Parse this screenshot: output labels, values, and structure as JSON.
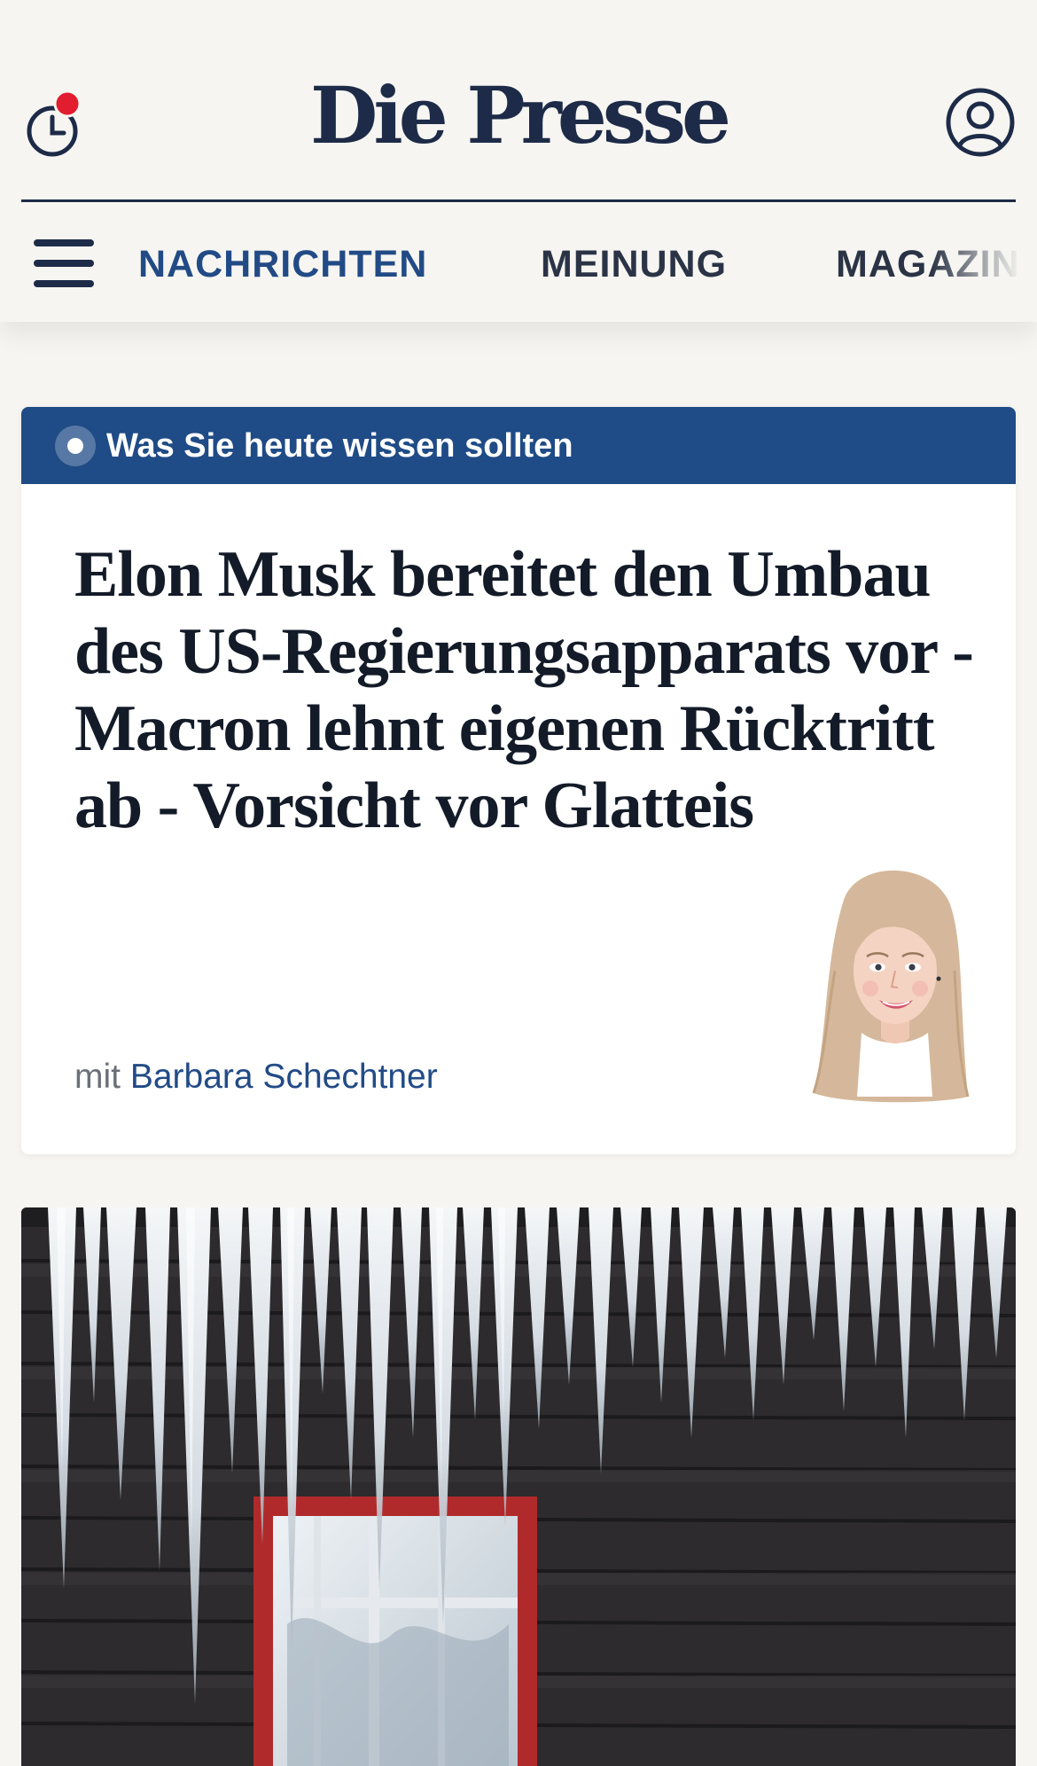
{
  "app": {
    "logo_text": "Die Presse",
    "brand_color": "#1d2b48",
    "accent_color": "#1f4b86",
    "notification_color": "#e11d2f"
  },
  "header": {
    "history_icon": "clock-history-icon",
    "history_has_notification": true,
    "account_icon": "user-account-icon",
    "menu_icon": "hamburger-menu-icon"
  },
  "nav": {
    "items": [
      {
        "label": "NACHRICHTEN",
        "active": true
      },
      {
        "label": "MEINUNG",
        "active": false
      },
      {
        "label": "MAGAZIN",
        "active": false
      }
    ]
  },
  "briefing": {
    "banner_label": "Was Sie heute wissen sollten",
    "banner_icon": "live-dot-icon",
    "headline": "Elon Musk bereitet den Umbau des US-Regierungsapparats vor - Macron lehnt eigenen Rücktritt ab - Vorsicht vor Glatteis",
    "byline_prefix": "mit",
    "author": "Barbara Schechtner",
    "author_avatar": "author-illustration"
  },
  "article": {
    "image": "icicles-on-wooden-house-with-red-window"
  }
}
